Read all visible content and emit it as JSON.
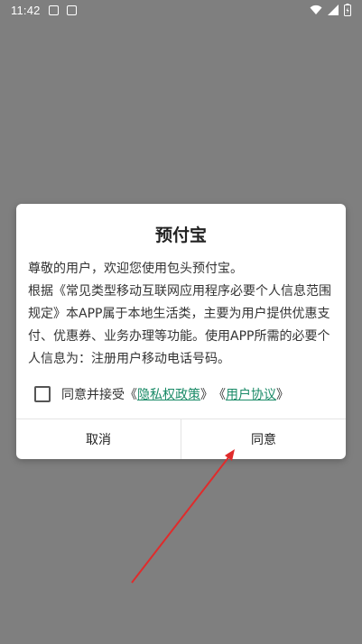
{
  "status_bar": {
    "time": "11:42",
    "notification_icons": [
      "nfc-icon",
      "font-icon"
    ],
    "system_icons": [
      "wifi-icon",
      "signal-icon",
      "battery-charging-icon"
    ]
  },
  "dialog": {
    "title": "预付宝",
    "greeting": "尊敬的用户，欢迎您使用包头预付宝。",
    "body": "根据《常见类型移动互联网应用程序必要个人信息范围规定》本APP属于本地生活类，主要为用户提供优惠支付、优惠券、业务办理等功能。使用APP所需的必要个人信息为：注册用户移动电话号码。",
    "consent": {
      "prefix": "同意并接受",
      "open1": "《",
      "privacy_link": "隐私权政策",
      "close1": "》",
      "open2": "《",
      "agreement_link": "用户协议",
      "close2": "》",
      "checked": false
    },
    "cancel_label": "取消",
    "agree_label": "同意"
  },
  "colors": {
    "overlay": "#7f7f7f",
    "link": "#1a8a67",
    "arrow": "#e02b2b"
  }
}
